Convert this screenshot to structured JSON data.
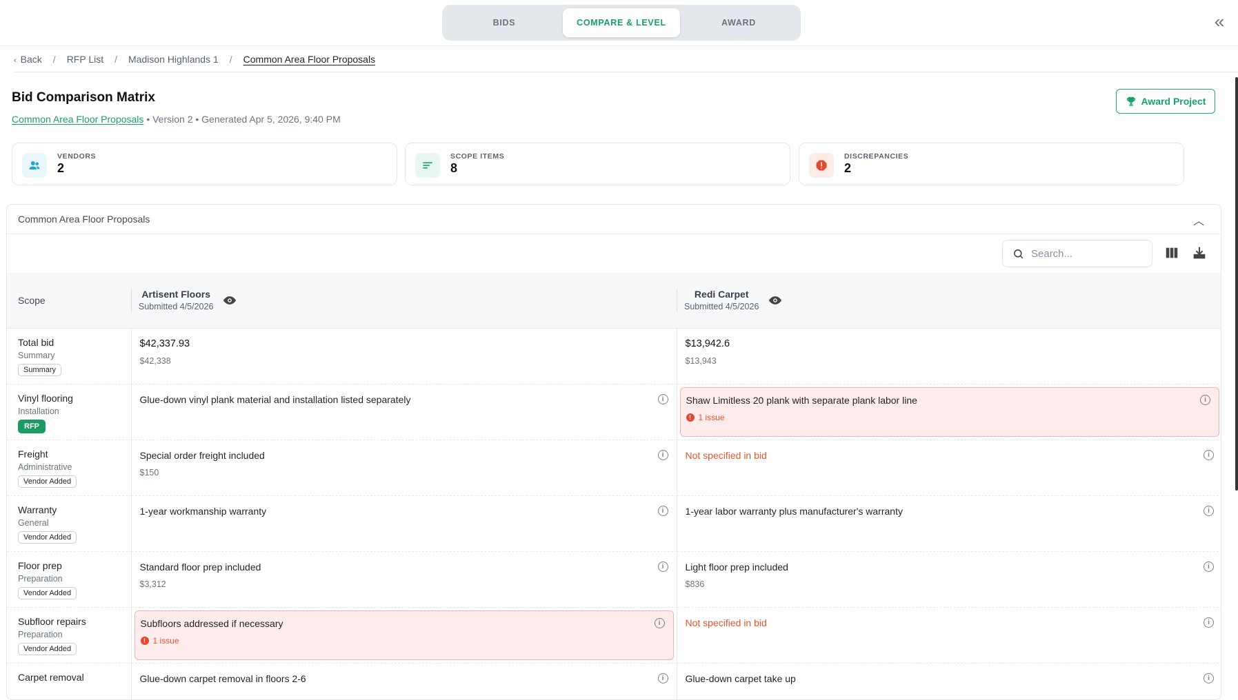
{
  "tabs": [
    {
      "label": "BIDS"
    },
    {
      "label": "COMPARE & LEVEL"
    },
    {
      "label": "AWARD"
    }
  ],
  "breadcrumb": {
    "back": "Back",
    "items": [
      "RFP List",
      "Madison Highlands 1",
      "Common Area Floor Proposals"
    ]
  },
  "header": {
    "title": "Bid Comparison Matrix",
    "link": "Common Area Floor Proposals",
    "meta": "• Version 2 • Generated Apr 5, 2026, 9:40 PM",
    "award_label": "Award Project"
  },
  "stats": [
    {
      "label": "VENDORS",
      "value": "2",
      "icon": "users-icon",
      "color": "#1fa7c9",
      "bg": "#e6f6fa"
    },
    {
      "label": "SCOPE ITEMS",
      "value": "8",
      "icon": "list-icon",
      "color": "#21a56d",
      "bg": "#e7f6ee"
    },
    {
      "label": "DISCREPANCIES",
      "value": "2",
      "icon": "alert-icon",
      "color": "#e5482e",
      "bg": "#fdebe7"
    }
  ],
  "panel": {
    "title": "Common Area Floor Proposals",
    "search_placeholder": "Search..."
  },
  "table": {
    "scope_header": "Scope",
    "vendors": [
      {
        "name": "Artisent Floors",
        "submitted": "Submitted 4/5/2026"
      },
      {
        "name": "Redi Carpet",
        "submitted": "Submitted 4/5/2026"
      }
    ],
    "rows": [
      {
        "name": "Total bid",
        "category": "Summary",
        "tag": "Summary",
        "tag_type": "plain",
        "cells": [
          {
            "text": "$42,337.93",
            "amount": "$42,338",
            "kind": "total"
          },
          {
            "text": "$13,942.6",
            "amount": "$13,943",
            "kind": "total"
          }
        ]
      },
      {
        "name": "Vinyl flooring",
        "category": "Installation",
        "tag": "RFP",
        "tag_type": "rfp",
        "cells": [
          {
            "text": "Glue-down vinyl plank material and installation listed separately",
            "amount": "",
            "kind": "normal"
          },
          {
            "text": "Shaw Limitless 20 plank with separate plank labor line",
            "issue": "1 issue",
            "kind": "issue"
          }
        ]
      },
      {
        "name": "Freight",
        "category": "Administrative",
        "tag": "Vendor Added",
        "tag_type": "plain",
        "cells": [
          {
            "text": "Special order freight included",
            "amount": "$150",
            "kind": "normal"
          },
          {
            "text": "Not specified in bid",
            "kind": "missing"
          }
        ]
      },
      {
        "name": "Warranty",
        "category": "General",
        "tag": "Vendor Added",
        "tag_type": "plain",
        "cells": [
          {
            "text": "1-year workmanship warranty",
            "amount": "",
            "kind": "normal"
          },
          {
            "text": "1-year labor warranty plus manufacturer's warranty",
            "amount": "",
            "kind": "normal"
          }
        ]
      },
      {
        "name": "Floor prep",
        "category": "Preparation",
        "tag": "Vendor Added",
        "tag_type": "plain",
        "cells": [
          {
            "text": "Standard floor prep included",
            "amount": "$3,312",
            "kind": "normal"
          },
          {
            "text": "Light floor prep included",
            "amount": "$836",
            "kind": "normal"
          }
        ]
      },
      {
        "name": "Subfloor repairs",
        "category": "Preparation",
        "tag": "Vendor Added",
        "tag_type": "plain",
        "cells": [
          {
            "text": "Subfloors addressed if necessary",
            "issue": "1 issue",
            "kind": "issue"
          },
          {
            "text": "Not specified in bid",
            "kind": "missing"
          }
        ]
      },
      {
        "name": "Carpet removal",
        "category": "",
        "tag": "",
        "tag_type": "plain",
        "cells": [
          {
            "text": "Glue-down carpet removal in floors 2-6",
            "amount": "",
            "kind": "normal"
          },
          {
            "text": "Glue-down carpet take up",
            "amount": "",
            "kind": "normal"
          }
        ]
      }
    ]
  }
}
